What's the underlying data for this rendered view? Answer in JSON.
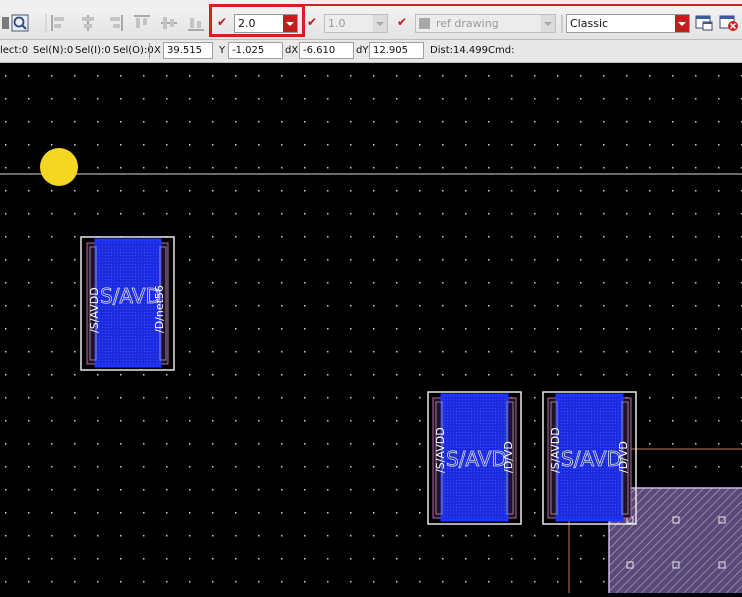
{
  "toolbar": {
    "line_width_value": "2.0",
    "secondary_value": "1.0",
    "ref_drawing_label": "ref drawing",
    "theme_value": "Classic",
    "check_mark": "✔"
  },
  "status": {
    "select": "lect:0",
    "sel_n": "Sel(N):0",
    "sel_i": "Sel(I):0",
    "sel_o": "Sel(O):0",
    "x_label": "X",
    "x_value": "39.515",
    "y_label": "Y",
    "y_value": "-1.025",
    "dx_label": "dX",
    "dx_value": "-6.610",
    "dy_label": "dY",
    "dy_value": "12.905",
    "dist": "Dist:14.499",
    "cmd": "Cmd:"
  },
  "layout_canvas": {
    "cursor_color": "#f5d623",
    "device_fill": "#1a2be0",
    "instance_1": {
      "net_label": "S/AVD",
      "left_pin": "/S/AVDD",
      "right_pin": "/D/net56"
    },
    "instance_2": {
      "net_label": "S/AVD",
      "left_pin": "/S/AVDD",
      "right_pin": "/D/VD"
    },
    "instance_3": {
      "net_label": "S/AVD",
      "left_pin": "/S/AVDD",
      "right_pin": "/D/VD"
    }
  }
}
